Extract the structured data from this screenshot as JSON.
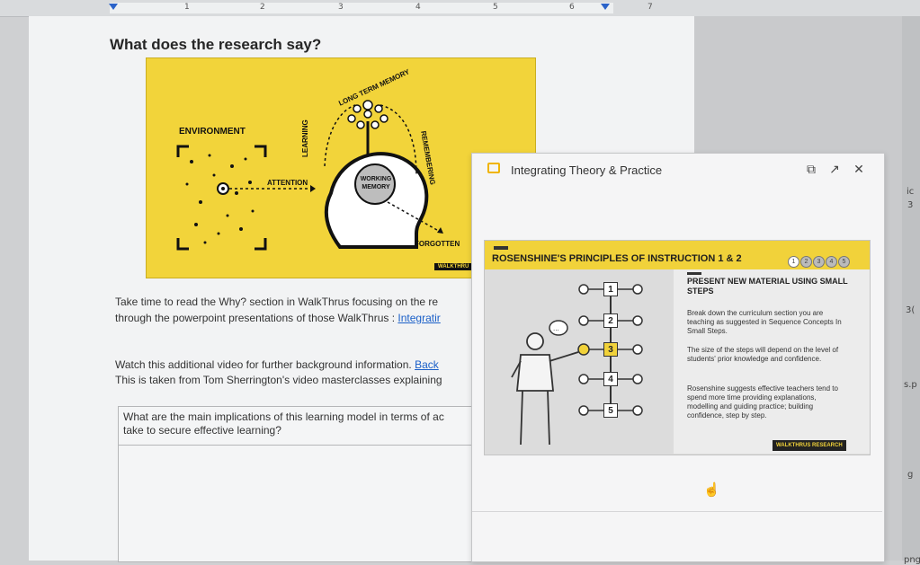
{
  "ruler": {
    "numbers": [
      "1",
      "2",
      "3",
      "4",
      "5",
      "6",
      "7"
    ]
  },
  "document": {
    "heading": "What does the research say?",
    "figure": {
      "labels": {
        "environment": "ENVIRONMENT",
        "attention": "ATTENTION",
        "learning": "LEARNING",
        "long_term_memory": "LONG TERM MEMORY",
        "remembering": "REMEMBERING",
        "working_memory": "WORKING MEMORY",
        "forgotten": "FORGOTTEN",
        "logo": "WALKTHRU"
      }
    },
    "para1_line1": "Take time to read the Why? section in WalkThrus focusing on the re",
    "para1_line2_prefix": "through the powerpoint presentations of those WalkThrus : ",
    "para1_link": "Integratir",
    "para2_line1_prefix": "Watch this additional video for further background information. ",
    "para2_link": "Back",
    "para2_line2": "This is taken from Tom Sherrington's video masterclasses explaining",
    "question_line1": "What are the main implications of this learning model in terms of ac",
    "question_line2": "take to secure effective learning?"
  },
  "popup": {
    "title": "Integrating Theory & Practice",
    "buttons": {
      "copy": "⧉",
      "open": "↗",
      "close": "✕"
    },
    "slide": {
      "title": "ROSENSHINE'S PRINCIPLES OF INSTRUCTION 1 & 2",
      "dots": [
        "1",
        "2",
        "3",
        "4",
        "5"
      ],
      "steps": [
        "1",
        "2",
        "3",
        "4",
        "5"
      ],
      "subtitle": "PRESENT NEW MATERIAL USING SMALL STEPS",
      "p1": "Break down the curriculum section you are teaching as suggested in Sequence Concepts In Small Steps.",
      "p2": "The size of the steps will depend on the level of students' prior knowledge and confidence.",
      "p3": "Rosenshine suggests effective teachers tend to spend more time providing explanations, modelling and guiding practice; building confidence, step by step.",
      "logo": "WALKTHRUS  RESEARCH",
      "bubble": "..."
    }
  },
  "edge": {
    "t1": "ic",
    "t2": "3",
    "t3": "3(",
    "t4": "s.p",
    "t5": "g",
    "t6": "png"
  },
  "colors": {
    "accent_yellow": "#f2d43a",
    "link_blue": "#1a5fc8",
    "popup_icon": "#f0b400"
  }
}
